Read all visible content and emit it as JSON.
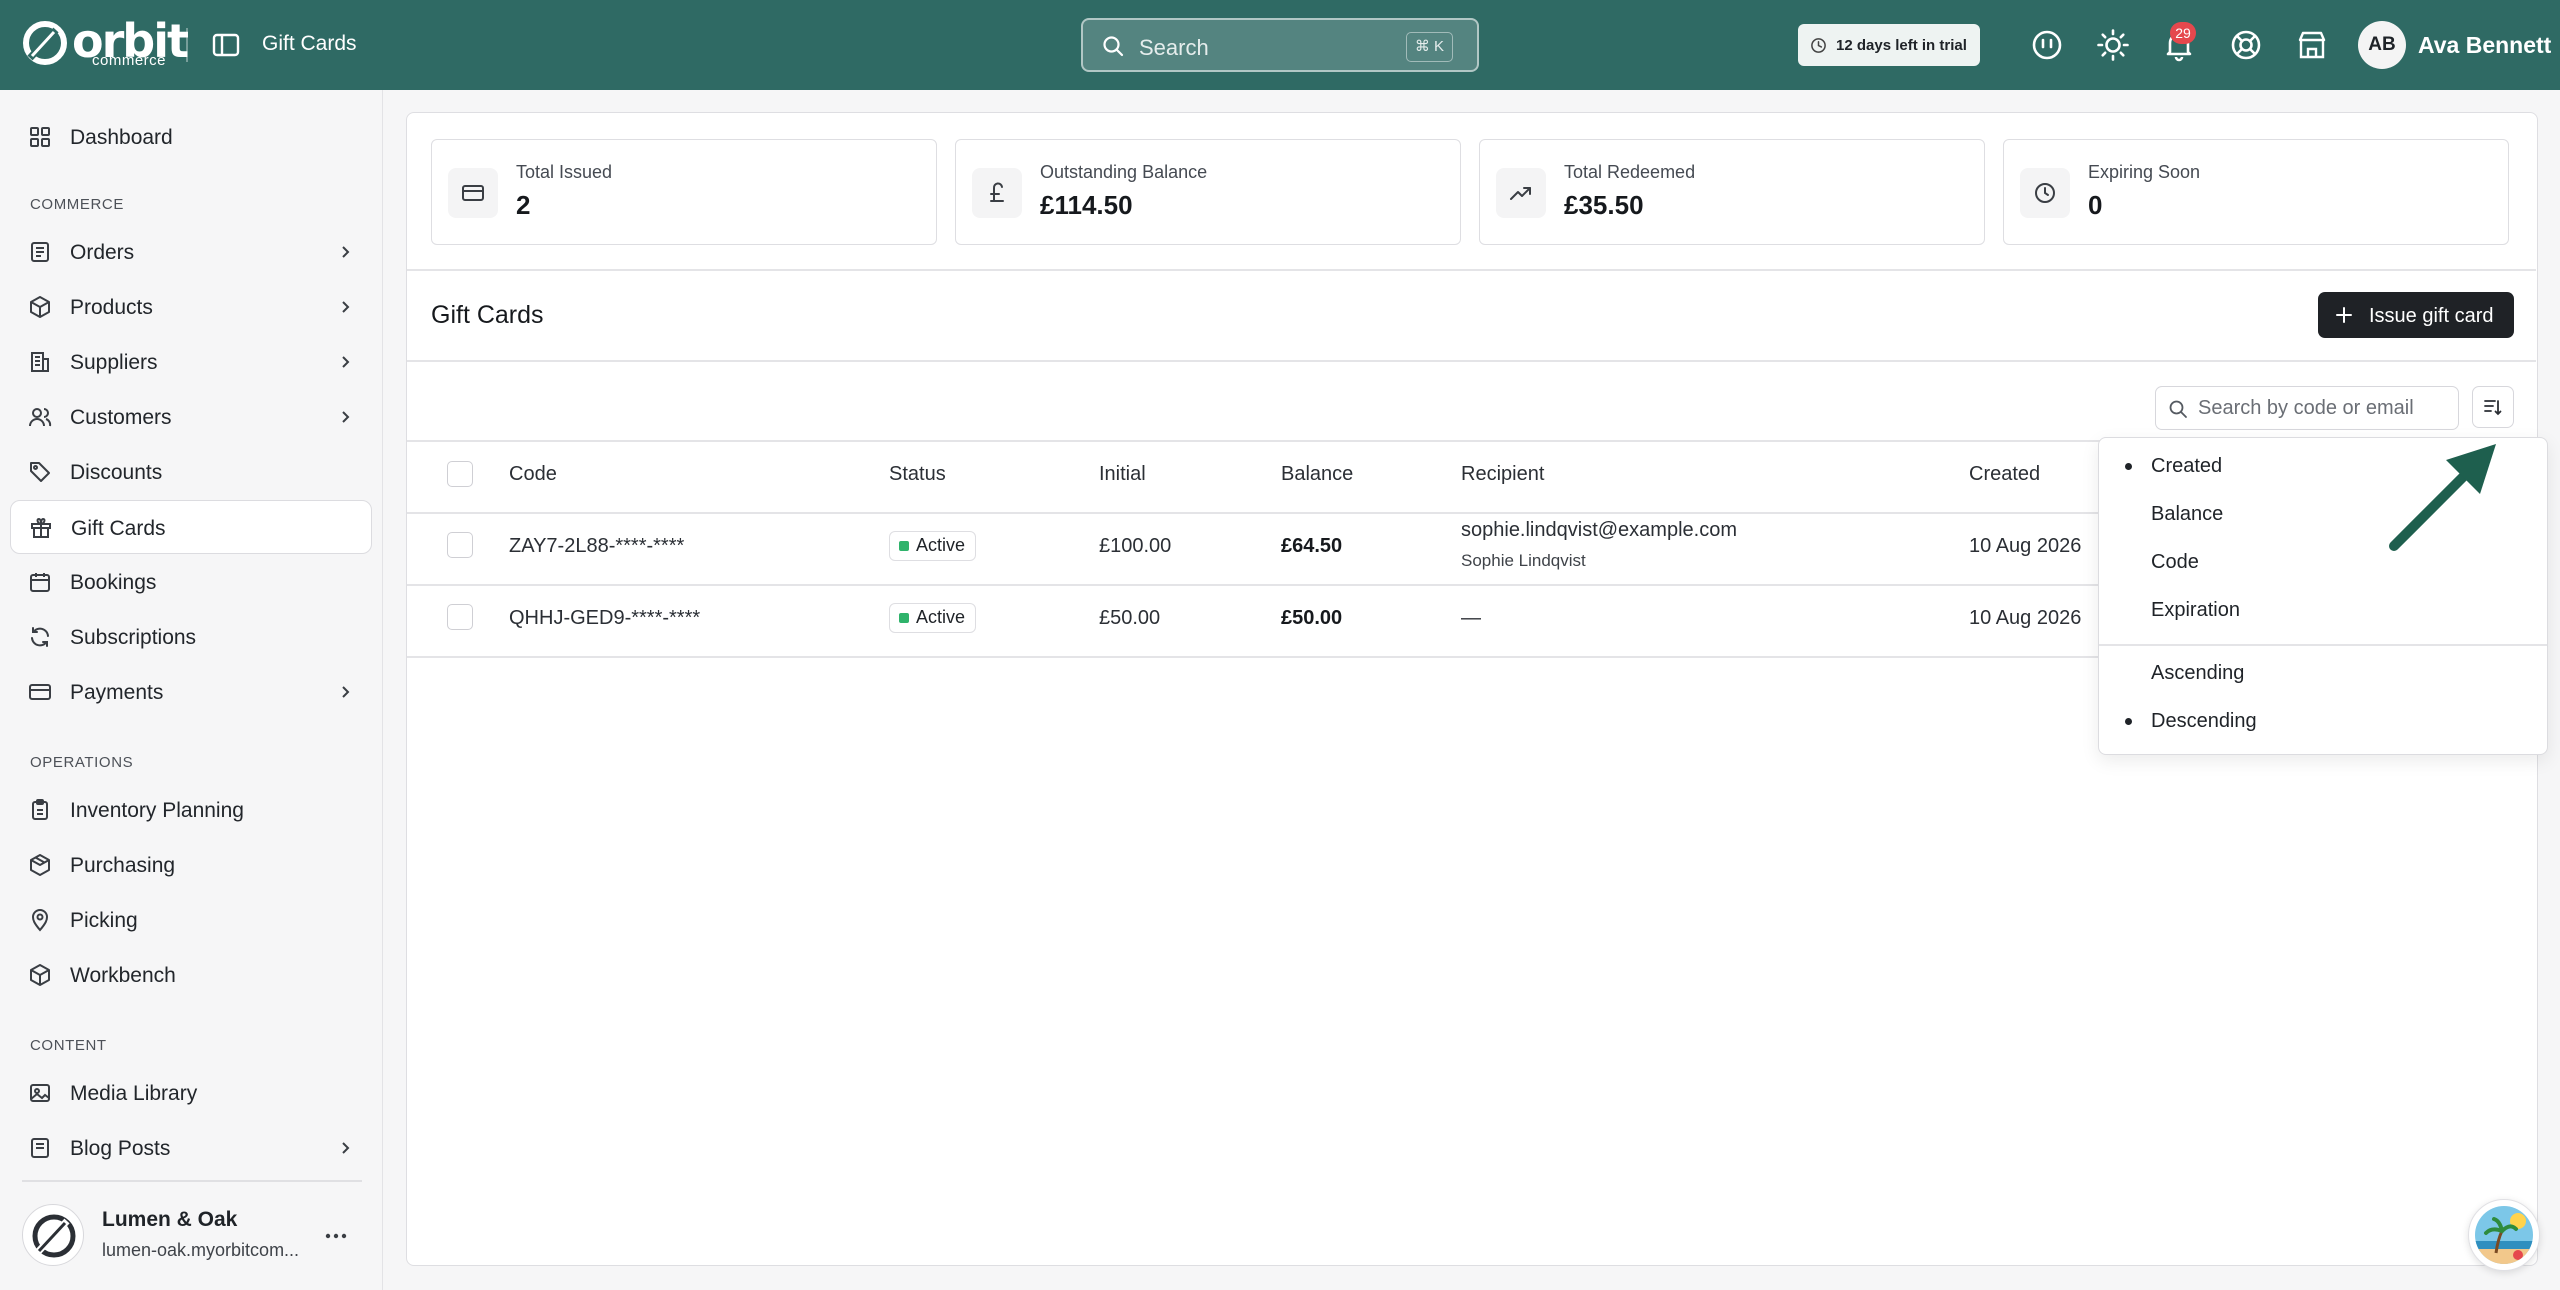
{
  "topbar": {
    "brand": "orbit",
    "brand_sub": "commerce",
    "page_label": "Gift Cards",
    "search_placeholder": "Search",
    "search_shortcut": "⌘ K",
    "trial_text": "12 days left in trial",
    "notification_count": "29",
    "user_initials": "AB",
    "user_name": "Ava Bennett"
  },
  "sidebar": {
    "dashboard": "Dashboard",
    "section_commerce": "COMMERCE",
    "commerce_items": [
      {
        "label": "Orders"
      },
      {
        "label": "Products"
      },
      {
        "label": "Suppliers"
      },
      {
        "label": "Customers"
      },
      {
        "label": "Discounts"
      },
      {
        "label": "Gift Cards"
      },
      {
        "label": "Bookings"
      },
      {
        "label": "Subscriptions"
      },
      {
        "label": "Payments"
      }
    ],
    "section_operations": "OPERATIONS",
    "operations_items": [
      {
        "label": "Inventory Planning"
      },
      {
        "label": "Purchasing"
      },
      {
        "label": "Picking"
      },
      {
        "label": "Workbench"
      }
    ],
    "section_content": "CONTENT",
    "content_items": [
      {
        "label": "Media Library"
      },
      {
        "label": "Blog Posts"
      }
    ],
    "store": {
      "name": "Lumen & Oak",
      "domain": "lumen-oak.myorbitcom..."
    }
  },
  "stats": [
    {
      "label": "Total Issued",
      "value": "2"
    },
    {
      "label": "Outstanding Balance",
      "value": "£114.50"
    },
    {
      "label": "Total Redeemed",
      "value": "£35.50"
    },
    {
      "label": "Expiring Soon",
      "value": "0"
    }
  ],
  "gift_cards": {
    "title": "Gift Cards",
    "issue_button": "Issue gift card",
    "search_placeholder": "Search by code or email",
    "columns": [
      "Code",
      "Status",
      "Initial",
      "Balance",
      "Recipient",
      "Created"
    ],
    "rows": [
      {
        "code": "ZAY7-2L88-****-****",
        "status": "Active",
        "initial": "£100.00",
        "balance": "£64.50",
        "recipient_email": "sophie.lindqvist@example.com",
        "recipient_name": "Sophie Lindqvist",
        "created": "10 Aug 2026"
      },
      {
        "code": "QHHJ-GED9-****-****",
        "status": "Active",
        "initial": "£50.00",
        "balance": "£50.00",
        "recipient": "—",
        "created": "10 Aug 2026"
      }
    ]
  },
  "sort_menu": {
    "fields": [
      "Created",
      "Balance",
      "Code",
      "Expiration"
    ],
    "selected_field": "Created",
    "orders": [
      "Ascending",
      "Descending"
    ],
    "selected_order": "Descending"
  },
  "colors": {
    "topbar": "#2f6a64",
    "status_active": "#2fb36b",
    "pointer_arrow": "#1e5f4e",
    "badge": "#e5484d"
  }
}
